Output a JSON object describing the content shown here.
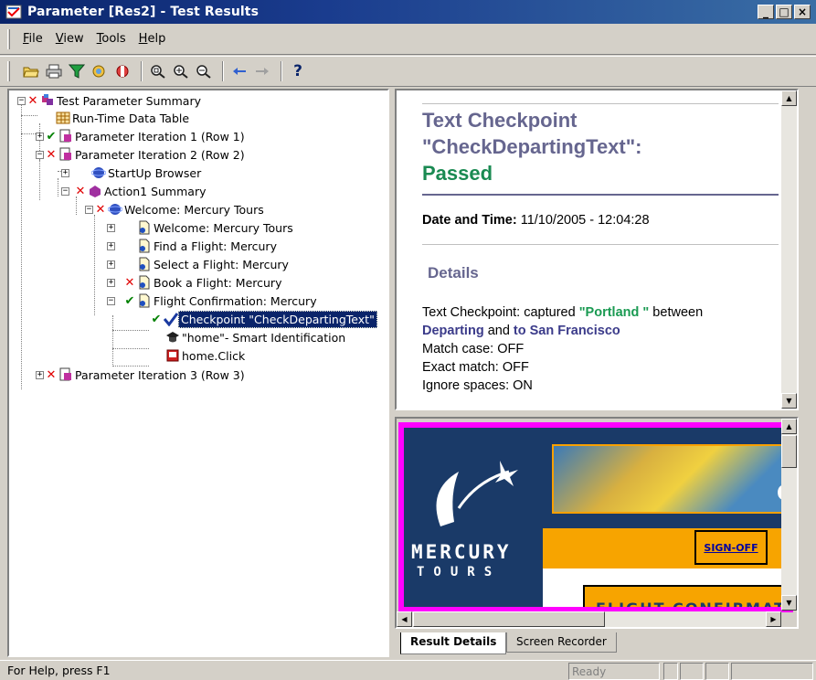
{
  "window": {
    "title": "Parameter [Res2] - Test Results",
    "buttons": [
      "_",
      "□",
      "×"
    ]
  },
  "menu": [
    {
      "label": "File",
      "underline": "F",
      "rest": "ile"
    },
    {
      "label": "View",
      "underline": "V",
      "rest": "iew"
    },
    {
      "label": "Tools",
      "underline": "T",
      "rest": "ools"
    },
    {
      "label": "Help",
      "underline": "H",
      "rest": "elp"
    }
  ],
  "toolbar": {
    "icons": [
      "open-icon",
      "print-icon",
      "filter-icon",
      "find-icon",
      "settings-icon",
      "zoom-fit-icon",
      "zoom-in-icon",
      "zoom-out-icon",
      "back-arrow-icon",
      "forward-arrow-icon",
      "help-icon"
    ],
    "help_glyph": "?"
  },
  "tree": {
    "nodes": [
      {
        "label": "Test Parameter Summary",
        "status": "fail"
      },
      {
        "label": "Run-Time Data Table",
        "status": ""
      },
      {
        "label": "Parameter Iteration 1 (Row 1)",
        "status": "pass"
      },
      {
        "label": "Parameter Iteration 2 (Row 2)",
        "status": "fail"
      },
      {
        "label": "StartUp Browser",
        "status": ""
      },
      {
        "label": "Action1 Summary",
        "status": "fail"
      },
      {
        "label": "Welcome: Mercury Tours",
        "status": "fail"
      },
      {
        "label": "Welcome: Mercury Tours",
        "status": ""
      },
      {
        "label": "Find a Flight: Mercury",
        "status": ""
      },
      {
        "label": "Select a Flight: Mercury",
        "status": ""
      },
      {
        "label": "Book a Flight: Mercury",
        "status": "fail"
      },
      {
        "label": "Flight Confirmation: Mercury",
        "status": "pass"
      },
      {
        "label": "Checkpoint \"CheckDepartingText\"",
        "status": "pass",
        "selected": true
      },
      {
        "label": "\"home\"- Smart Identification",
        "status": ""
      },
      {
        "label": "home.Click",
        "status": ""
      },
      {
        "label": "Parameter Iteration 3 (Row 3)",
        "status": "fail"
      }
    ]
  },
  "details": {
    "title_line1": "Text Checkpoint",
    "title_line2": "\"CheckDepartingText\":",
    "title_status": "Passed",
    "date_label": "Date and Time:",
    "date_value": " 11/10/2005 - 12:04:28",
    "section": "Details",
    "captured_prefix": "Text Checkpoint: captured ",
    "captured_value": "\"Portland \"",
    "captured_between": " between",
    "departing": "Departing",
    "and": " and ",
    "destination": "to San Francisco",
    "match_case": "Match case: OFF",
    "exact_match": "Exact match: OFF",
    "ignore_spaces": "Ignore spaces: ON"
  },
  "screenshot": {
    "logo_line1": "MERCURY",
    "logo_line2": "TOURS",
    "signoff": "SIGN-OFF",
    "banner": "FLIGHT CONFIRMATIO",
    "partial": "O"
  },
  "tabs": [
    {
      "label": "Result Details",
      "active": true
    },
    {
      "label": "Screen Recorder",
      "active": false
    }
  ],
  "status": {
    "help": "For Help, press F1",
    "ready": "Ready"
  },
  "colors": {
    "title_bar": "#0a246a",
    "checkpoint_title": "#66668f",
    "passed": "#1a8a52",
    "highlight_border": "#ff00ff"
  }
}
